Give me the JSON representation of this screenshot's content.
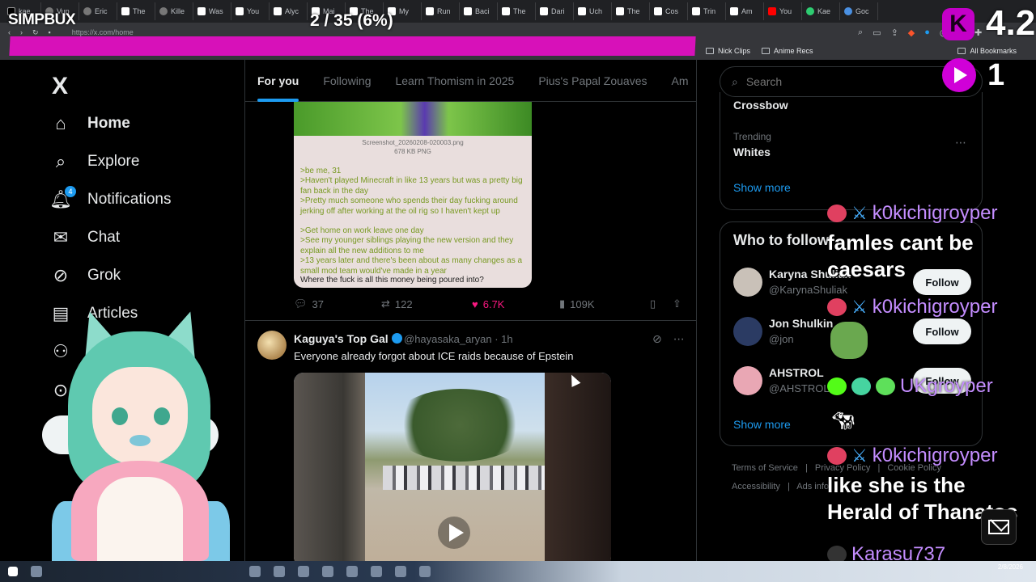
{
  "browser": {
    "tabs": [
      "kae",
      "Vup",
      "Eric",
      "The",
      "Kille",
      "Was",
      "You",
      "Alyc",
      "Mai",
      "The",
      "My",
      "Run",
      "Baci",
      "The",
      "Dari",
      "Uch",
      "The",
      "Cos",
      "Trin",
      "Am",
      "You",
      "Kae",
      "Goc"
    ],
    "url": "https://x.com/home",
    "bookmarks": [
      "Nick Clips",
      "Anime Recs"
    ],
    "bookmarks_right": "All Bookmarks"
  },
  "stream_overlay": {
    "brand": "SIMPBUX",
    "counter": "2 / 35 (6%)",
    "k_value": "4.2",
    "viewer_count": "1",
    "progress_fraction": 0.06
  },
  "nav": {
    "logo": "X",
    "items": [
      {
        "label": "Home",
        "icon": "home-icon"
      },
      {
        "label": "Explore",
        "icon": "search-icon"
      },
      {
        "label": "Notifications",
        "icon": "bell-icon",
        "badge": "4"
      },
      {
        "label": "Chat",
        "icon": "mail-icon"
      },
      {
        "label": "Grok",
        "icon": "grok-icon"
      },
      {
        "label": "Articles",
        "icon": "articles-icon"
      }
    ]
  },
  "feed": {
    "tabs": [
      "For you",
      "Following",
      "Learn Thomism in 2025",
      "Pius's Papal Zouaves",
      "Am"
    ],
    "post1": {
      "image": {
        "filename": "Screenshot_20260208-020003.png",
        "filesize": "678 KB PNG",
        "lines": [
          ">be me, 31",
          ">Haven't played Minecraft in like 13 years but was a pretty big fan back in the day",
          ">Pretty much someone who spends their day fucking around jerking off after working at the oil rig so I haven't kept up",
          ">Get home on work leave one day",
          ">See my younger siblings playing the new version and they explain all the new additions to me",
          ">13 years later and there's been about as many changes as a small mod team would've made in a year"
        ],
        "last_line": "Where the fuck is all this money being poured into?"
      },
      "replies": "37",
      "reposts": "122",
      "likes": "6.7K",
      "views": "109K"
    },
    "post2": {
      "name": "Kaguya's Top Gal",
      "handle": "@hayasaka_aryan · 1h",
      "text": "Everyone already forgot about ICE raids because of Epstein"
    }
  },
  "sidebar": {
    "search_placeholder": "Search",
    "trend_top": "Crossbow",
    "trend_category": "Trending",
    "trend_name": "Whites",
    "show_more": "Show more",
    "who_to_follow": {
      "title": "Who to follow",
      "accounts": [
        {
          "name": "Karyna Shuliak",
          "handle": "@KarynaShuliak",
          "button": "Follow"
        },
        {
          "name": "Jon Shulkin",
          "handle": "@jon",
          "button": "Follow"
        },
        {
          "name": "AHSTROL",
          "handle": "@AHSTROL",
          "button": "Follow"
        }
      ],
      "show_more": "Show more"
    },
    "footer": [
      "Terms of Service",
      "|",
      "Privacy Policy",
      "|",
      "Cookie Policy",
      "Accessibility",
      "|",
      "Ads info"
    ]
  },
  "chat": {
    "messages": [
      {
        "user": "k0kichigroyper",
        "text": "famles cant be caesars"
      },
      {
        "user": "k0kichigroyper",
        "text": ""
      },
      {
        "user": "UKgroyper",
        "text": ""
      },
      {
        "user": "k0kichigroyper",
        "text": "like she is the Herald of Thanatos"
      },
      {
        "user": "Karasu737",
        "text": ""
      }
    ]
  },
  "taskbar": {
    "date": "2/8/2026"
  }
}
